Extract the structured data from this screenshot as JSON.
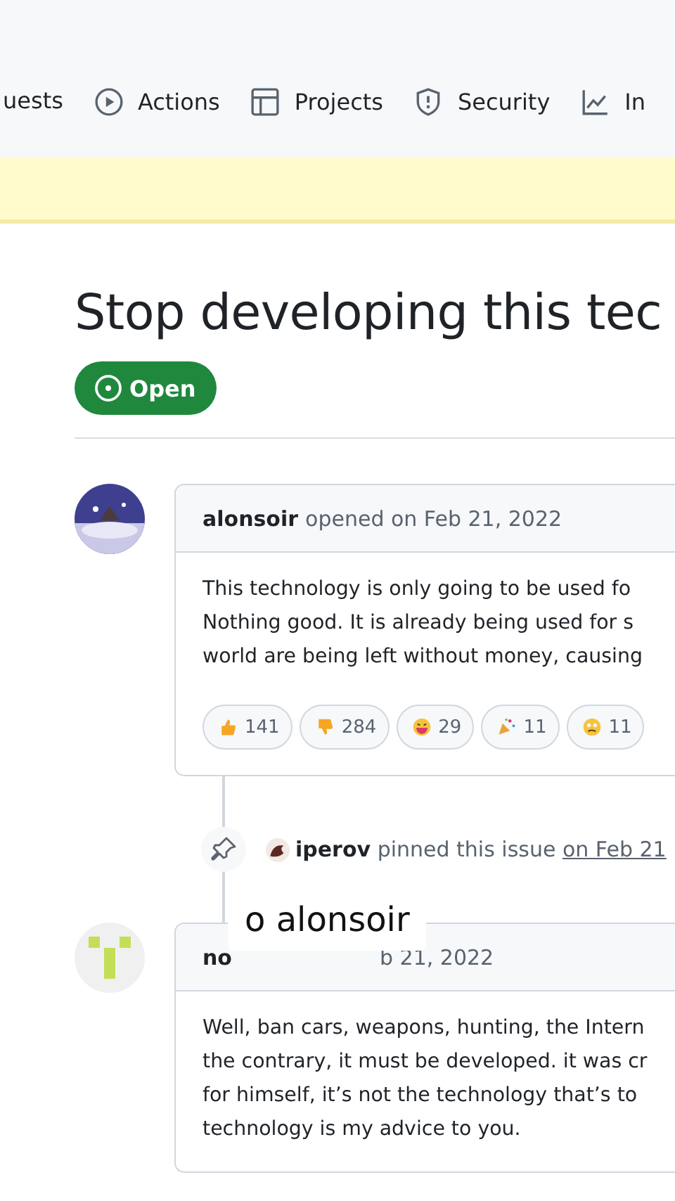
{
  "nav": [
    {
      "label": "uests",
      "selected": false
    },
    {
      "label": "Actions",
      "selected": false
    },
    {
      "label": "Projects",
      "selected": false
    },
    {
      "label": "Security",
      "selected": false
    },
    {
      "label": "In",
      "selected": false
    }
  ],
  "issue": {
    "title": "Stop developing this tec",
    "state_label": "Open"
  },
  "comments": [
    {
      "author": "alonsoir",
      "meta": "opened on Feb 21, 2022",
      "body": [
        "This technology is only going to be used fo",
        "Nothing good. It is already being used for s",
        "world are being left without money, causing"
      ],
      "reactions": [
        {
          "kind": "thumbs-up",
          "count": "141"
        },
        {
          "kind": "thumbs-down",
          "count": "284"
        },
        {
          "kind": "laugh",
          "count": "29"
        },
        {
          "kind": "hooray",
          "count": "11"
        },
        {
          "kind": "confused",
          "count": "11"
        }
      ]
    },
    {
      "author": "no",
      "meta": "b 21, 2022",
      "body": [
        "Well, ban cars, weapons, hunting, the Intern",
        "the contrary, it must be developed. it was cr",
        "for himself, it’s not the technology that’s to",
        "technology is my advice to you."
      ]
    }
  ],
  "pin_event": {
    "actor": "iperov",
    "action": "pinned this issue",
    "date": "on Feb 21"
  },
  "caption": "o alonsoir"
}
